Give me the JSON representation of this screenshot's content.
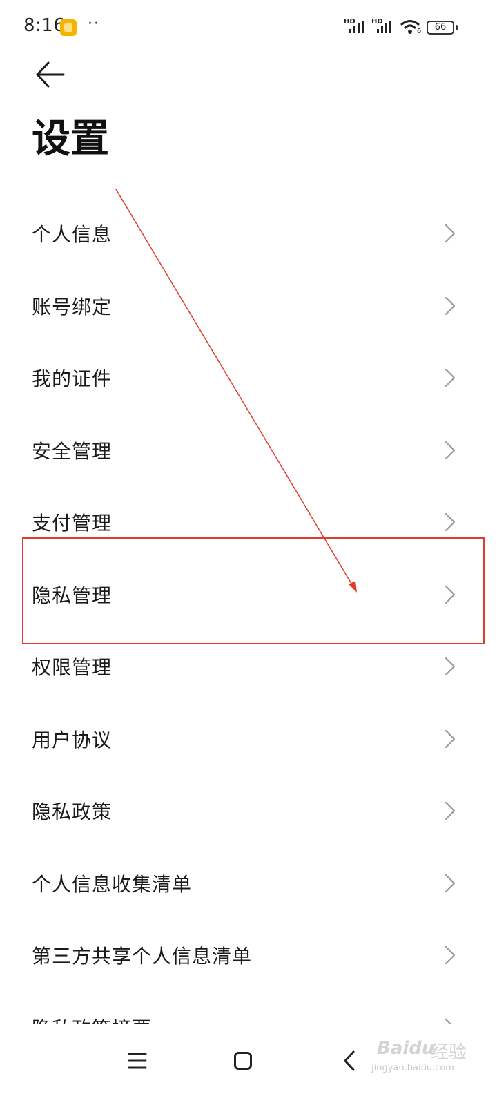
{
  "status_bar": {
    "time": "8:16",
    "dots": "··",
    "hd_label_1": "HD",
    "hd_label_2": "HD",
    "battery": "66",
    "wifi_sub": "6"
  },
  "header": {
    "back_icon": "back-arrow-icon",
    "title": "设置"
  },
  "menu_items": [
    {
      "label": "个人信息"
    },
    {
      "label": "账号绑定"
    },
    {
      "label": "我的证件"
    },
    {
      "label": "安全管理"
    },
    {
      "label": "支付管理"
    },
    {
      "label": "隐私管理"
    },
    {
      "label": "权限管理"
    },
    {
      "label": "用户协议"
    },
    {
      "label": "隐私政策"
    },
    {
      "label": "个人信息收集清单"
    },
    {
      "label": "第三方共享个人信息清单"
    },
    {
      "label": "隐私政策摘要"
    }
  ],
  "annotation": {
    "highlighted_item": "隐私管理",
    "color": "#e23b2e"
  },
  "nav_bar": {
    "menu_icon": "menu-icon",
    "home_icon": "home-icon",
    "back_icon": "back-icon"
  },
  "watermark": {
    "brand": "Baidu",
    "cn": "经验",
    "url": "jingyan.baidu.com"
  }
}
